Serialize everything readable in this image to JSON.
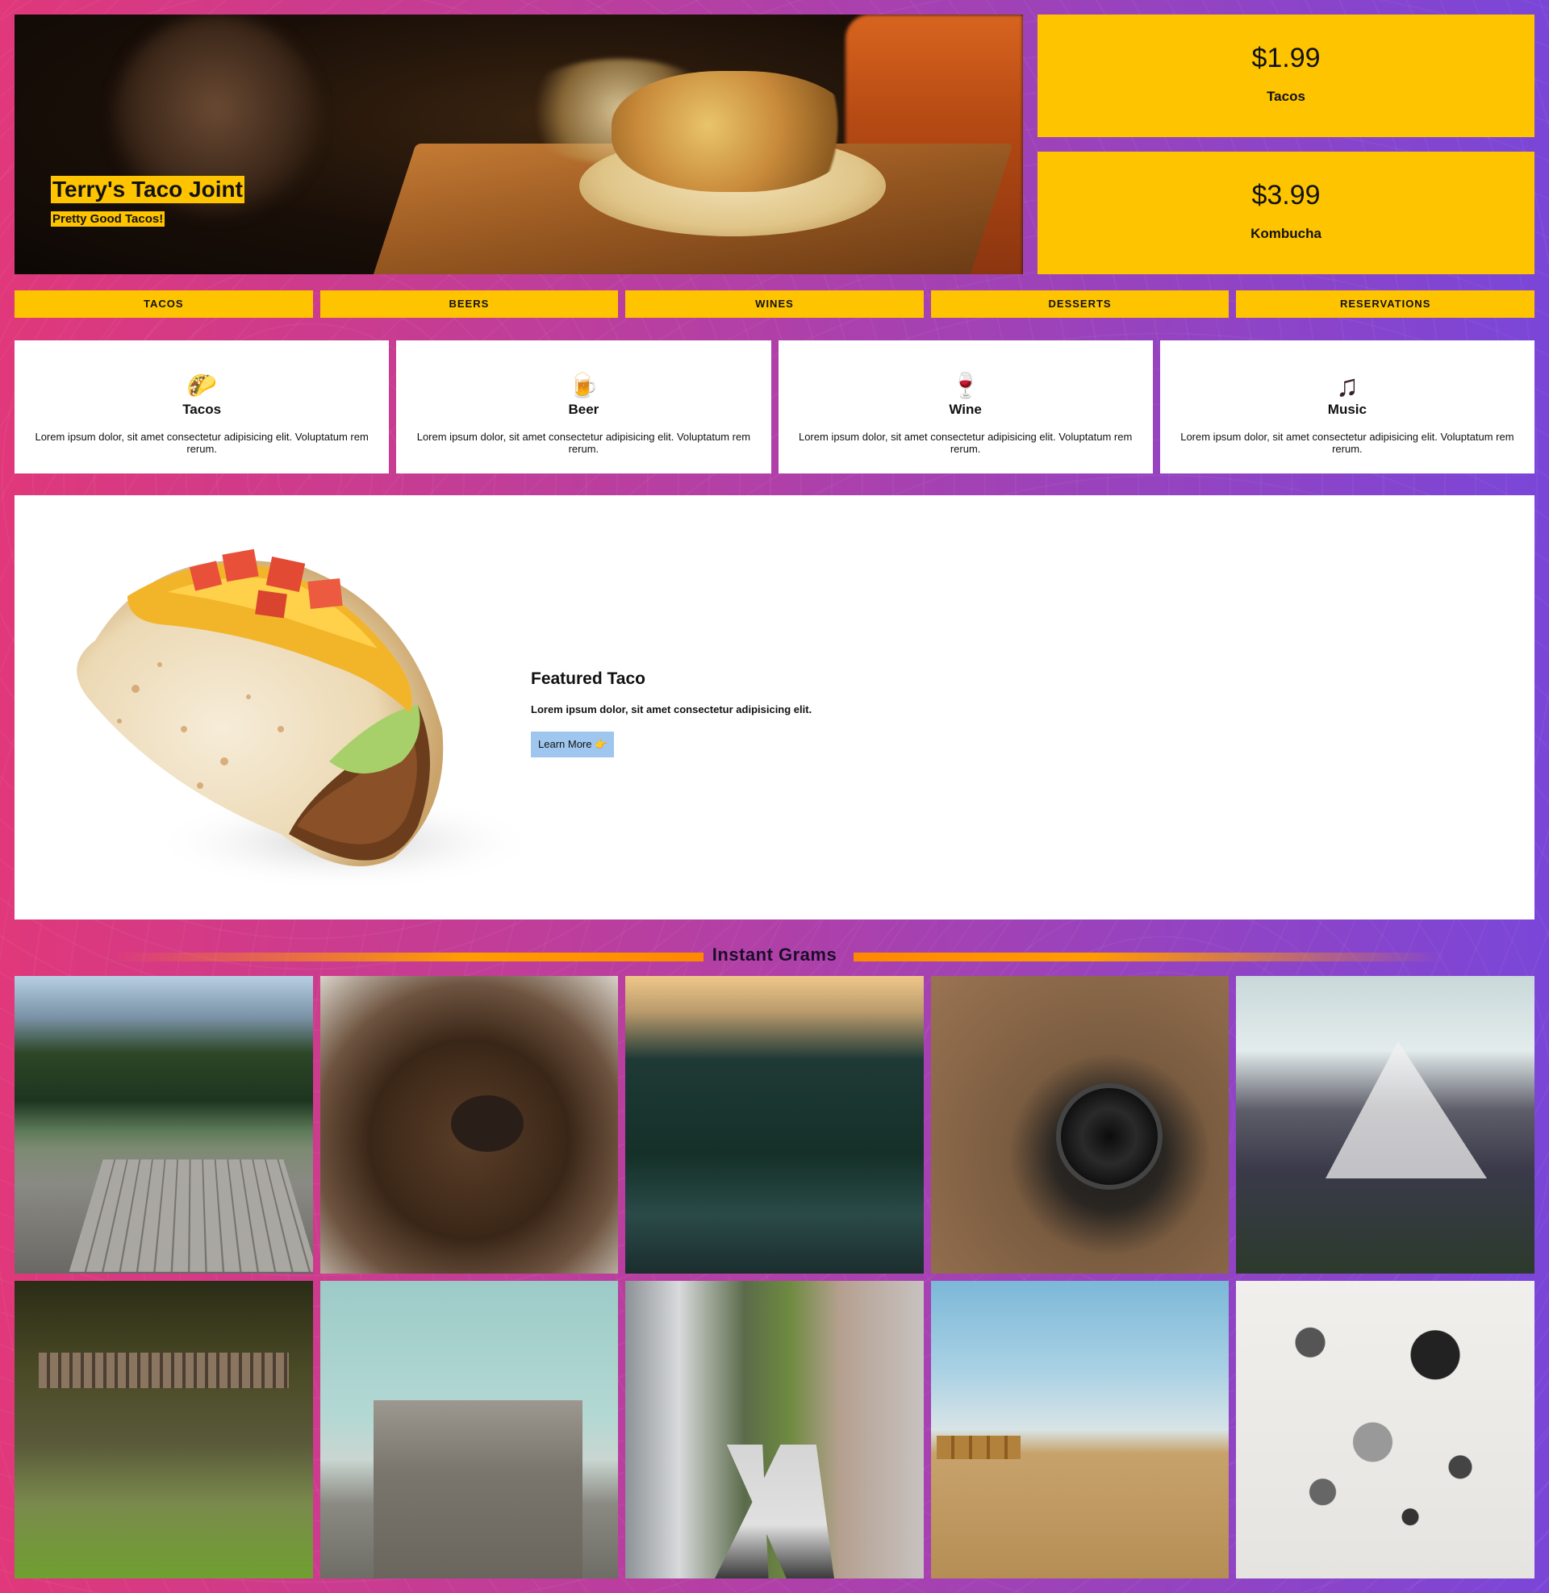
{
  "hero": {
    "title": "Terry's Taco Joint",
    "subtitle": "Pretty Good Tacos!"
  },
  "prices": [
    {
      "amount": "$1.99",
      "label": "Tacos"
    },
    {
      "amount": "$3.99",
      "label": "Kombucha"
    }
  ],
  "nav": {
    "items": [
      "TACOS",
      "BEERS",
      "WINES",
      "DESSERTS",
      "RESERVATIONS"
    ]
  },
  "features": [
    {
      "icon": "taco-icon",
      "glyph": "🌮",
      "title": "Tacos",
      "text": "Lorem ipsum dolor, sit amet consectetur adipisicing elit. Voluptatum rem rerum."
    },
    {
      "icon": "beer-icon",
      "glyph": "🍺",
      "title": "Beer",
      "text": "Lorem ipsum dolor, sit amet consectetur adipisicing elit. Voluptatum rem rerum."
    },
    {
      "icon": "wine-icon",
      "glyph": "🍷",
      "title": "Wine",
      "text": "Lorem ipsum dolor, sit amet consectetur adipisicing elit. Voluptatum rem rerum."
    },
    {
      "icon": "music-icon",
      "glyph": "♫",
      "title": "Music",
      "text": "Lorem ipsum dolor, sit amet consectetur adipisicing elit. Voluptatum rem rerum."
    }
  ],
  "featured": {
    "title": "Featured Taco",
    "text": "Lorem ipsum dolor, sit amet consectetur adipisicing elit.",
    "button_label": "Learn More 👉"
  },
  "grams": {
    "title": "Instant Grams",
    "photos": [
      "lake-dock-photo",
      "bear-photo",
      "forest-photo",
      "camera-photo",
      "mountain-photo",
      "old-pier-photo",
      "bunker-photo",
      "city-feet-photo",
      "farm-field-photo",
      "parts-flatlay-photo"
    ]
  },
  "colors": {
    "accent": "#ffc400",
    "button": "#9fc6ef",
    "gradient_start": "#e0387a",
    "gradient_end": "#7a46d8"
  }
}
